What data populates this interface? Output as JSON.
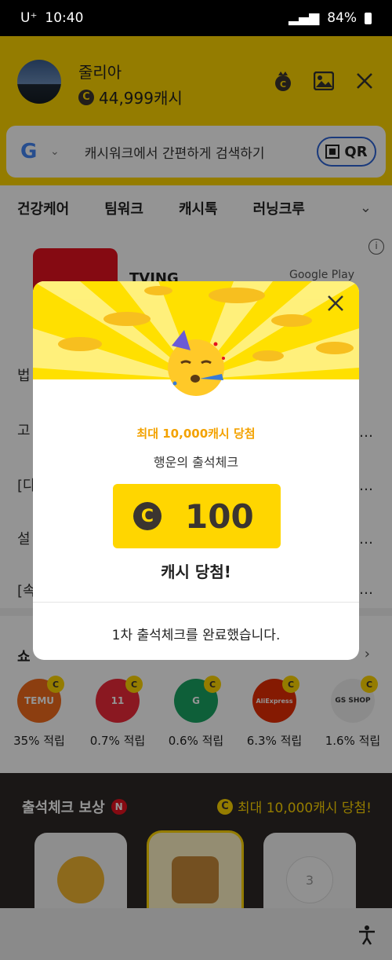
{
  "status_bar": {
    "carrier": "U⁺",
    "time": "10:40",
    "battery": "84%"
  },
  "header": {
    "user_name": "줄리아",
    "cash_amount": "44,999캐시",
    "coin_symbol": "C"
  },
  "search": {
    "placeholder": "캐시워크에서 간편하게 검색하기",
    "qr_label": "QR"
  },
  "categories": [
    "건강케어",
    "팀워크",
    "캐시톡",
    "러닝크루"
  ],
  "background": {
    "ad_app": "TVING",
    "ad_store": "Google Play",
    "rows": [
      "법",
      "고",
      "[다",
      "설",
      "[속"
    ],
    "shop_title": "쇼",
    "shops": [
      {
        "name": "TEMU",
        "rate": "35% 적립",
        "color": "#f26b1d"
      },
      {
        "name": "11",
        "rate": "0.7% 적립",
        "color": "#ee2a3a"
      },
      {
        "name": "G",
        "rate": "0.6% 적립",
        "color": "#19a463"
      },
      {
        "name": "AliExpress",
        "rate": "6.3% 적립",
        "color": "#e62e04"
      },
      {
        "name": "GS SHOP",
        "rate": "1.6% 적립",
        "color": "#f0f0f0"
      }
    ],
    "attend_title": "출석체크 보상",
    "attend_badge": "N",
    "attend_promo": "최대 10,000캐시 당첨!",
    "day3": "3"
  },
  "modal": {
    "promo_text": "최대 10,000캐시 당첨",
    "subtitle": "행운의 출석체크",
    "prize_amount": "100",
    "win_text": "캐시 당첨!",
    "done_text": "1차 출석체크를 완료했습니다."
  },
  "colors": {
    "brand_yellow": "#ffd600",
    "accent_orange": "#f3a200",
    "coin_dark": "#3b3530"
  }
}
